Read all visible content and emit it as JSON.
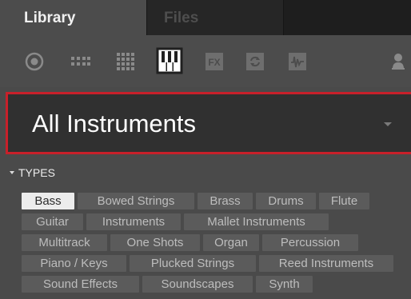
{
  "tabs": [
    {
      "label": "Library"
    },
    {
      "label": "Files"
    }
  ],
  "toolbar": {
    "fx_label": "FX"
  },
  "selector": {
    "label": "All Instruments"
  },
  "types": {
    "header": "TYPES",
    "items": [
      {
        "label": "Bass",
        "selected": true
      },
      {
        "label": "Bowed Strings"
      },
      {
        "label": "Brass"
      },
      {
        "label": "Drums"
      },
      {
        "label": "Flute"
      },
      {
        "label": "Guitar"
      },
      {
        "label": "Instruments"
      },
      {
        "label": "Mallet Instruments"
      },
      {
        "label": "Multitrack"
      },
      {
        "label": "One Shots"
      },
      {
        "label": "Organ"
      },
      {
        "label": "Percussion"
      },
      {
        "label": "Piano / Keys"
      },
      {
        "label": "Plucked Strings"
      },
      {
        "label": "Reed Instruments"
      },
      {
        "label": "Sound Effects"
      },
      {
        "label": "Soundscapes"
      },
      {
        "label": "Synth"
      }
    ]
  },
  "colors": {
    "accent_border": "#c8202a",
    "chip_bg": "#5b5b5b",
    "chip_selected_bg": "#ececec"
  }
}
